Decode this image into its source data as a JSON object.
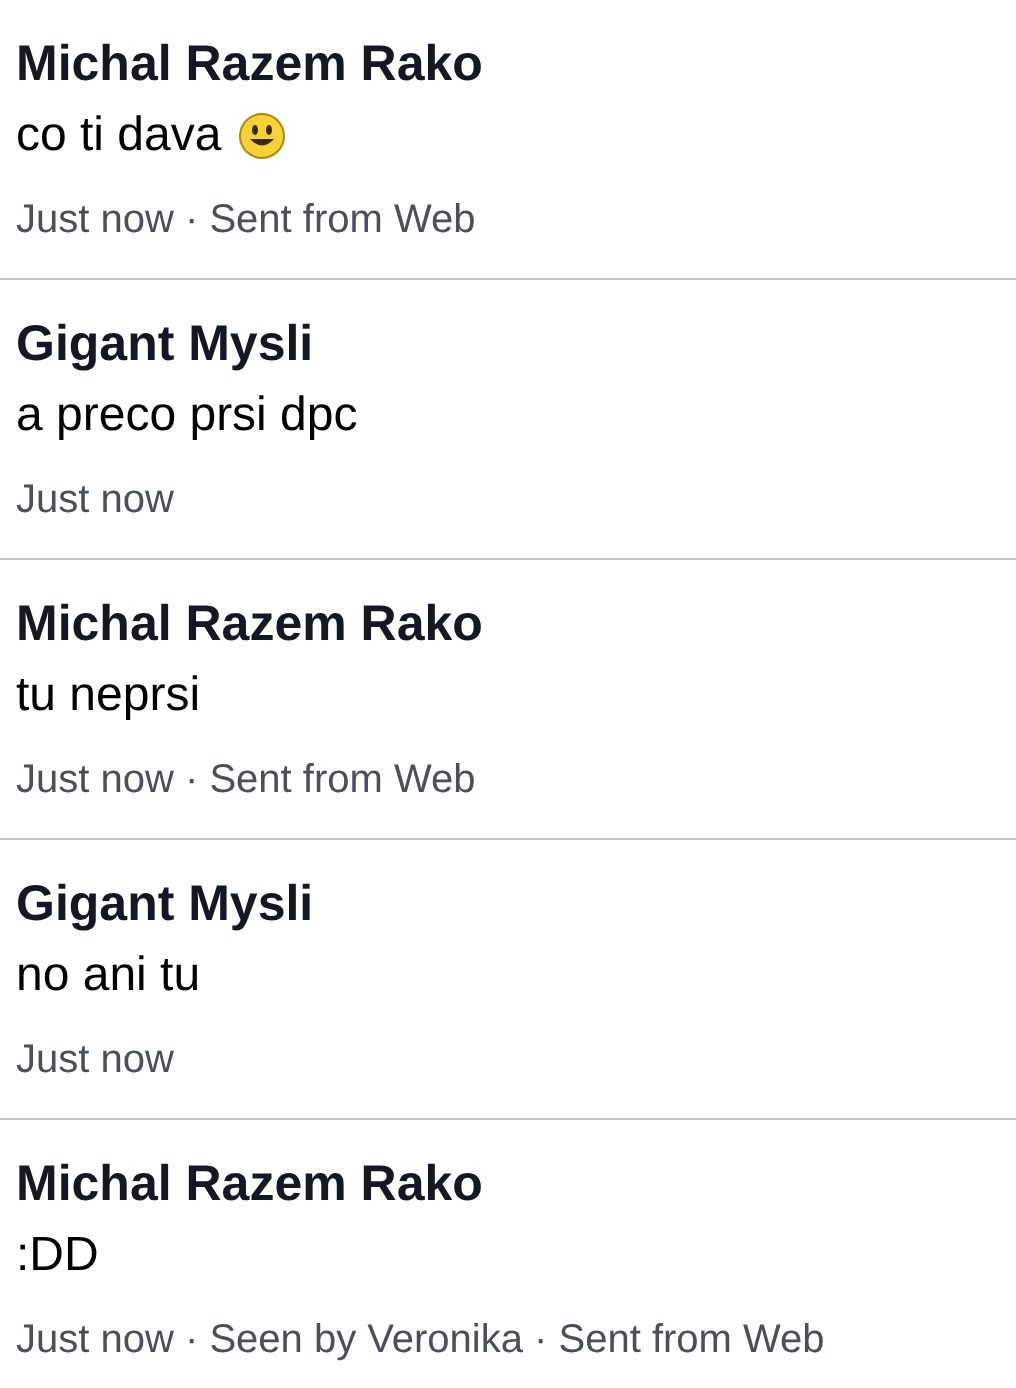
{
  "messages": [
    {
      "sender": "Michal Razem Rako",
      "text": "co ti dava",
      "emoji": true,
      "meta": "Just now · Sent from Web"
    },
    {
      "sender": "Gigant Mysli",
      "text": "a preco prsi dpc",
      "emoji": false,
      "meta": "Just now"
    },
    {
      "sender": "Michal Razem Rako",
      "text": "tu neprsi",
      "emoji": false,
      "meta": "Just now · Sent from Web"
    },
    {
      "sender": "Gigant Mysli",
      "text": "no ani tu",
      "emoji": false,
      "meta": "Just now"
    },
    {
      "sender": "Michal Razem Rako",
      "text": ":DD",
      "emoji": false,
      "meta": "Just now · Seen by Veronika · Sent from Web"
    }
  ]
}
